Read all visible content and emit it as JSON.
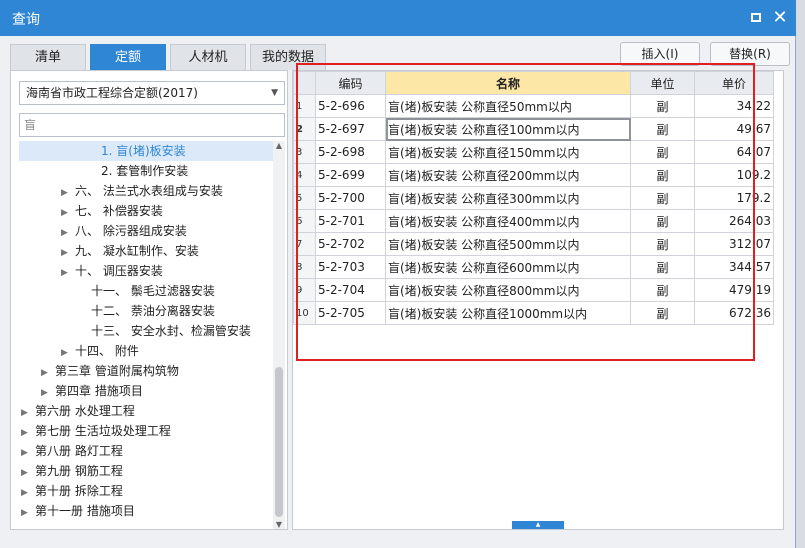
{
  "window": {
    "title": "查询",
    "max_icon": "maximize-icon",
    "close_icon": "close-icon"
  },
  "tabs": [
    {
      "label": "清单",
      "active": false
    },
    {
      "label": "定额",
      "active": true
    },
    {
      "label": "人材机",
      "active": false
    },
    {
      "label": "我的数据",
      "active": false
    }
  ],
  "buttons": {
    "insert": "插入(I)",
    "replace": "替换(R)"
  },
  "left": {
    "library": "海南省市政工程综合定额(2017)",
    "search_value": "盲",
    "tree": [
      {
        "text": "1. 盲(堵)板安装",
        "indent": 82,
        "arrow": "",
        "selected": true
      },
      {
        "text": "2. 套管制作安装",
        "indent": 82,
        "arrow": "",
        "selected": false
      },
      {
        "text": "六、 法兰式水表组成与安装",
        "indent": 56,
        "arrow": "▶",
        "selected": false
      },
      {
        "text": "七、 补偿器安装",
        "indent": 56,
        "arrow": "▶",
        "selected": false
      },
      {
        "text": "八、 除污器组成安装",
        "indent": 56,
        "arrow": "▶",
        "selected": false
      },
      {
        "text": "九、 凝水缸制作、安装",
        "indent": 56,
        "arrow": "▶",
        "selected": false
      },
      {
        "text": "十、 调压器安装",
        "indent": 56,
        "arrow": "▶",
        "selected": false
      },
      {
        "text": "十一、 鬃毛过滤器安装",
        "indent": 72,
        "arrow": "",
        "selected": false
      },
      {
        "text": "十二、 萘油分离器安装",
        "indent": 72,
        "arrow": "",
        "selected": false
      },
      {
        "text": "十三、 安全水封、检漏管安装",
        "indent": 72,
        "arrow": "",
        "selected": false
      },
      {
        "text": "十四、 附件",
        "indent": 56,
        "arrow": "▶",
        "selected": false
      },
      {
        "text": "第三章 管道附属构筑物",
        "indent": 36,
        "arrow": "▶",
        "selected": false
      },
      {
        "text": "第四章 措施项目",
        "indent": 36,
        "arrow": "▶",
        "selected": false
      },
      {
        "text": "第六册 水处理工程",
        "indent": 16,
        "arrow": "▶",
        "selected": false
      },
      {
        "text": "第七册 生活垃圾处理工程",
        "indent": 16,
        "arrow": "▶",
        "selected": false
      },
      {
        "text": "第八册 路灯工程",
        "indent": 16,
        "arrow": "▶",
        "selected": false
      },
      {
        "text": "第九册 钢筋工程",
        "indent": 16,
        "arrow": "▶",
        "selected": false
      },
      {
        "text": "第十册 拆除工程",
        "indent": 16,
        "arrow": "▶",
        "selected": false
      },
      {
        "text": "第十一册 措施项目",
        "indent": 16,
        "arrow": "▶",
        "selected": false
      }
    ]
  },
  "grid": {
    "headers": {
      "code": "编码",
      "name": "名称",
      "unit": "单位",
      "price": "单价"
    },
    "rows": [
      {
        "n": "1",
        "code": "5-2-696",
        "name": "盲(堵)板安装 公称直径50mm以内",
        "unit": "副",
        "price": "34.22"
      },
      {
        "n": "2",
        "code": "5-2-697",
        "name": "盲(堵)板安装 公称直径100mm以内",
        "unit": "副",
        "price": "49.67"
      },
      {
        "n": "3",
        "code": "5-2-698",
        "name": "盲(堵)板安装 公称直径150mm以内",
        "unit": "副",
        "price": "64.07"
      },
      {
        "n": "4",
        "code": "5-2-699",
        "name": "盲(堵)板安装 公称直径200mm以内",
        "unit": "副",
        "price": "109.2"
      },
      {
        "n": "5",
        "code": "5-2-700",
        "name": "盲(堵)板安装 公称直径300mm以内",
        "unit": "副",
        "price": "179.2"
      },
      {
        "n": "6",
        "code": "5-2-701",
        "name": "盲(堵)板安装 公称直径400mm以内",
        "unit": "副",
        "price": "264.03"
      },
      {
        "n": "7",
        "code": "5-2-702",
        "name": "盲(堵)板安装 公称直径500mm以内",
        "unit": "副",
        "price": "312.07"
      },
      {
        "n": "8",
        "code": "5-2-703",
        "name": "盲(堵)板安装 公称直径600mm以内",
        "unit": "副",
        "price": "344.57"
      },
      {
        "n": "9",
        "code": "5-2-704",
        "name": "盲(堵)板安装 公称直径800mm以内",
        "unit": "副",
        "price": "479.19"
      },
      {
        "n": "10",
        "code": "5-2-705",
        "name": "盲(堵)板安装 公称直径1000mm以内",
        "unit": "副",
        "price": "672.36"
      }
    ],
    "focused_row": 1
  },
  "colors": {
    "accent": "#2f86d4",
    "header_highlight": "#fde7a6",
    "annotation": "#e02020"
  }
}
